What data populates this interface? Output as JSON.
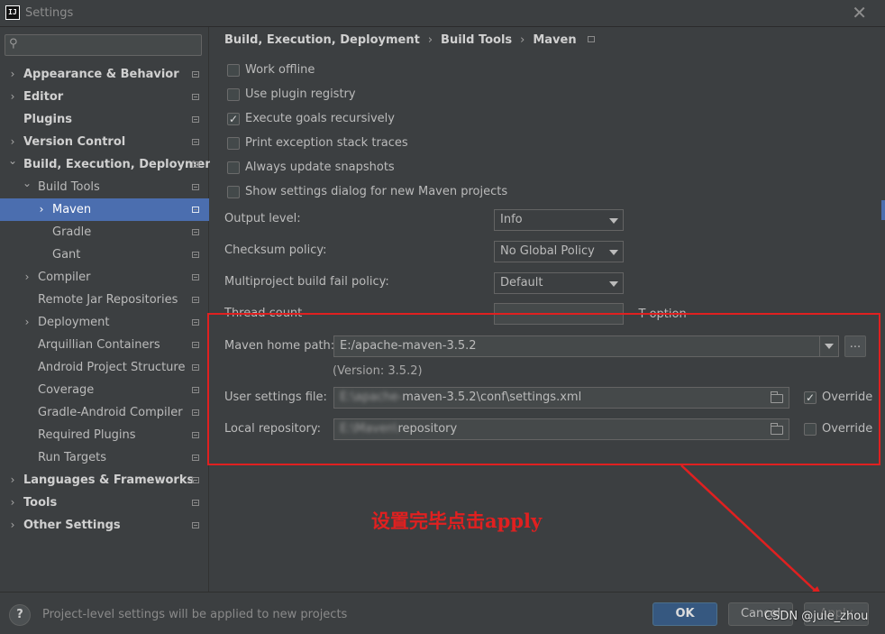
{
  "window": {
    "title": "Settings",
    "app_icon_text": "IJ"
  },
  "search": {
    "placeholder": ""
  },
  "sidebar": {
    "items": [
      {
        "label": "Appearance & Behavior",
        "bold": true,
        "arrow": "›"
      },
      {
        "label": "Editor",
        "bold": true,
        "arrow": "›"
      },
      {
        "label": "Plugins",
        "bold": true,
        "arrow": ""
      },
      {
        "label": "Version Control",
        "bold": true,
        "arrow": "›"
      },
      {
        "label": "Build, Execution, Deployment",
        "bold": true,
        "arrow": "⌄"
      },
      {
        "label": "Build Tools",
        "bold": false,
        "arrow": "⌄"
      },
      {
        "label": "Maven",
        "bold": false,
        "arrow": "›",
        "selected": true
      },
      {
        "label": "Gradle",
        "bold": false,
        "arrow": ""
      },
      {
        "label": "Gant",
        "bold": false,
        "arrow": ""
      },
      {
        "label": "Compiler",
        "bold": false,
        "arrow": "›"
      },
      {
        "label": "Remote Jar Repositories",
        "bold": false,
        "arrow": ""
      },
      {
        "label": "Deployment",
        "bold": false,
        "arrow": "›"
      },
      {
        "label": "Arquillian Containers",
        "bold": false,
        "arrow": ""
      },
      {
        "label": "Android Project Structure",
        "bold": false,
        "arrow": ""
      },
      {
        "label": "Coverage",
        "bold": false,
        "arrow": ""
      },
      {
        "label": "Gradle-Android Compiler",
        "bold": false,
        "arrow": ""
      },
      {
        "label": "Required Plugins",
        "bold": false,
        "arrow": ""
      },
      {
        "label": "Run Targets",
        "bold": false,
        "arrow": ""
      },
      {
        "label": "Languages & Frameworks",
        "bold": true,
        "arrow": "›"
      },
      {
        "label": "Tools",
        "bold": true,
        "arrow": "›"
      },
      {
        "label": "Other Settings",
        "bold": true,
        "arrow": "›"
      }
    ]
  },
  "breadcrumb": {
    "part1": "Build, Execution, Deployment",
    "part2": "Build Tools",
    "part3": "Maven",
    "separator": "›"
  },
  "options": {
    "work_offline": {
      "label": "Work offline",
      "checked": false
    },
    "plugin_registry": {
      "label": "Use plugin registry",
      "checked": false
    },
    "execute_goals": {
      "label": "Execute goals recursively",
      "checked": true
    },
    "print_exception": {
      "label": "Print exception stack traces",
      "checked": false
    },
    "always_update": {
      "label": "Always update snapshots",
      "checked": false
    },
    "show_settings_dialog": {
      "label": "Show settings dialog for new Maven projects",
      "checked": false
    }
  },
  "fields": {
    "output_level": {
      "label": "Output level:",
      "value": "Info"
    },
    "checksum_policy": {
      "label": "Checksum policy:",
      "value": "No Global Policy"
    },
    "multiproject_policy": {
      "label": "Multiproject build fail policy:",
      "value": "Default"
    },
    "thread_count": {
      "label": "Thread count",
      "value": "",
      "suffix": "-T option"
    },
    "maven_home": {
      "label": "Maven home path:",
      "value": "E:/apache-maven-3.5.2",
      "ellipsis": "...",
      "version": "(Version: 3.5.2)"
    },
    "user_settings": {
      "label": "User settings file:",
      "blurred_prefix": "E:\\apache-",
      "value": "maven-3.5.2\\conf\\settings.xml",
      "override_label": "Override",
      "override_checked": true
    },
    "local_repo": {
      "label": "Local repository:",
      "blurred_prefix": "E:\\Maven\\",
      "value": "repository",
      "override_label": "Override",
      "override_checked": false
    }
  },
  "annotation": {
    "text": "设置完毕点击apply",
    "color": "#e02020"
  },
  "footer": {
    "help_label": "?",
    "info_text": "Project-level settings will be applied to new projects",
    "ok_label": "OK",
    "cancel_label": "Cancel",
    "apply_label": "Apply"
  },
  "watermark": "CSDN @jule_zhou",
  "colors": {
    "accent": "#4b6eaf",
    "background": "#3c3f41",
    "annotation": "#e02020",
    "ok_button": "#365880"
  }
}
